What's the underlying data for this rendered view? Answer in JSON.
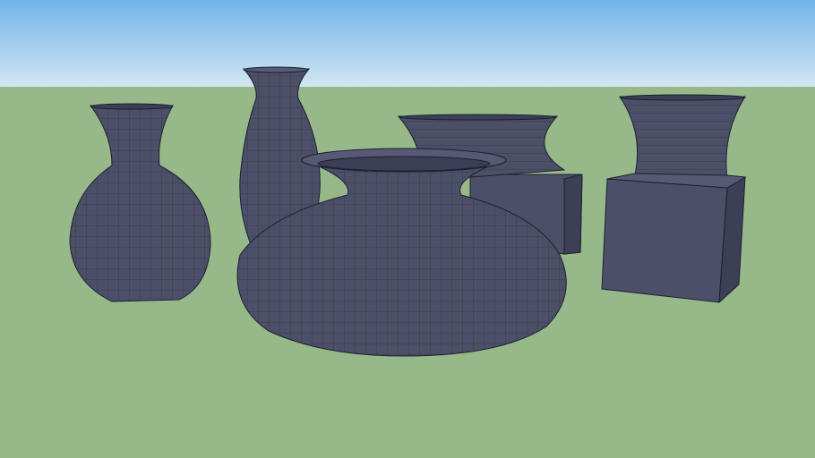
{
  "scene": {
    "colors": {
      "sky_top": "#72b4ea",
      "sky_horizon": "#d2e6f2",
      "ground": "#97b98a",
      "vase_fill": "#4b4f68",
      "vase_dark": "#3c3f55",
      "vase_light": "#565a75",
      "edge": "#1e2030"
    },
    "objects": [
      "bulb-vase",
      "tall-vase",
      "wide-squat-vase",
      "box-vase-back",
      "box-vase-right"
    ]
  }
}
